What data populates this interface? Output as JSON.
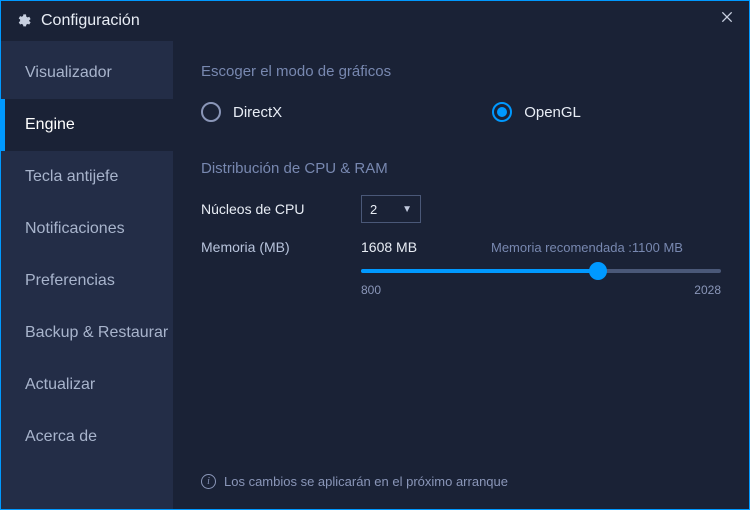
{
  "titlebar": {
    "title": "Configuración"
  },
  "sidebar": {
    "items": [
      {
        "label": "Visualizador",
        "active": false
      },
      {
        "label": "Engine",
        "active": true
      },
      {
        "label": "Tecla antijefe",
        "active": false
      },
      {
        "label": "Notificaciones",
        "active": false
      },
      {
        "label": "Preferencias",
        "active": false
      },
      {
        "label": "Backup & Restaurar",
        "active": false
      },
      {
        "label": "Actualizar",
        "active": false
      },
      {
        "label": "Acerca de",
        "active": false
      }
    ]
  },
  "graphics": {
    "heading": "Escoger el modo de gráficos",
    "options": {
      "directx": {
        "label": "DirectX",
        "checked": false
      },
      "opengl": {
        "label": "OpenGL",
        "checked": true
      }
    }
  },
  "distribution": {
    "heading": "Distribución de CPU & RAM",
    "cpu": {
      "label": "Núcleos de CPU",
      "value": "2"
    },
    "memory": {
      "label": "Memoria (MB)",
      "value_display": "1608 MB",
      "value": 1608,
      "recommended_label": "Memoria recomendada :1100 MB",
      "min": 800,
      "max": 2028,
      "min_label": "800",
      "max_label": "2028"
    }
  },
  "footer": {
    "note": "Los cambios se aplicarán en el próximo arranque"
  }
}
